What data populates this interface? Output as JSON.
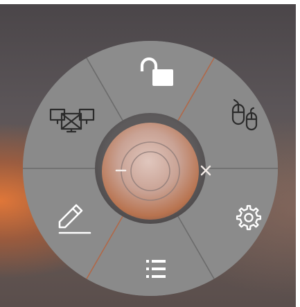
{
  "radial_menu": {
    "colors": {
      "sector_fill": "#8a8a8a",
      "sector_divider": "#6b6b6b",
      "icon_white": "#ffffff",
      "icon_dark": "#2b2b2b",
      "orange_glow": "#e07a3a"
    },
    "sectors": [
      {
        "id": "lock",
        "icon": "unlock-icon"
      },
      {
        "id": "mouse",
        "icon": "mouse-icon"
      },
      {
        "id": "settings",
        "icon": "gear-icon"
      },
      {
        "id": "list",
        "icon": "list-icon"
      },
      {
        "id": "annotate",
        "icon": "pen-icon"
      },
      {
        "id": "screens",
        "icon": "screen-share-icon"
      }
    ],
    "center": {
      "minimize_icon": "minus-icon",
      "close_icon": "close-icon"
    }
  }
}
